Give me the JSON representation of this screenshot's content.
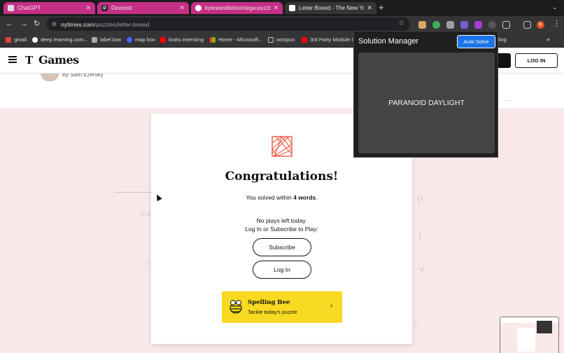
{
  "tabs": [
    {
      "title": "ChatGPT",
      "favicon": "chatgpt-icon"
    },
    {
      "title": "Devpost",
      "favicon": "devpost-icon",
      "badge": "D"
    },
    {
      "title": "kylewandishin/mega-puzzle-",
      "favicon": "github-icon"
    },
    {
      "title": "Letter Boxed - The New York",
      "favicon": "nyt-icon"
    }
  ],
  "toolbar": {
    "url_host": "nytimes.com",
    "url_path": "/puzzles/letter-boxed",
    "profile_initial": "K"
  },
  "bookmarks": [
    {
      "label": "gmail"
    },
    {
      "label": "deep learning.com..."
    },
    {
      "label": "label box"
    },
    {
      "label": "map box"
    },
    {
      "label": "looks intersting"
    },
    {
      "label": "Home - Microsoft..."
    },
    {
      "label": "octopus"
    },
    {
      "label": "3rd Party Module I..."
    },
    {
      "label": "ling"
    }
  ],
  "header": {
    "logo_t": "T",
    "logo_games": "Games",
    "login_label": "LOG IN"
  },
  "byline": {
    "text": "By Sam Ezersky"
  },
  "background_letters": [
    "P",
    "I",
    "Y",
    "PA",
    "T",
    "P",
    "C"
  ],
  "modal": {
    "title": "Congratulations!",
    "solved_prefix": "You solved within ",
    "solved_count": "4 words",
    "solved_suffix": ".",
    "no_plays": "No plays left today.",
    "login_prompt": "Log In or Subscribe to Play:",
    "subscribe_label": "Subscribe",
    "login_label": "Log In",
    "spelling_bee": {
      "title": "Spelling Bee",
      "subtitle": "Tackle today's puzzle"
    }
  },
  "extension": {
    "title": "Solution Manager",
    "autosolve_label": "Auto Solve",
    "solution": "PARANOID DAYLIGHT"
  },
  "colors": {
    "tab_accent": "#c62f86",
    "page_bg": "#f8e9e8",
    "spelling_bee_yellow": "#f7da21",
    "autosolve_blue": "#1a73e8"
  }
}
